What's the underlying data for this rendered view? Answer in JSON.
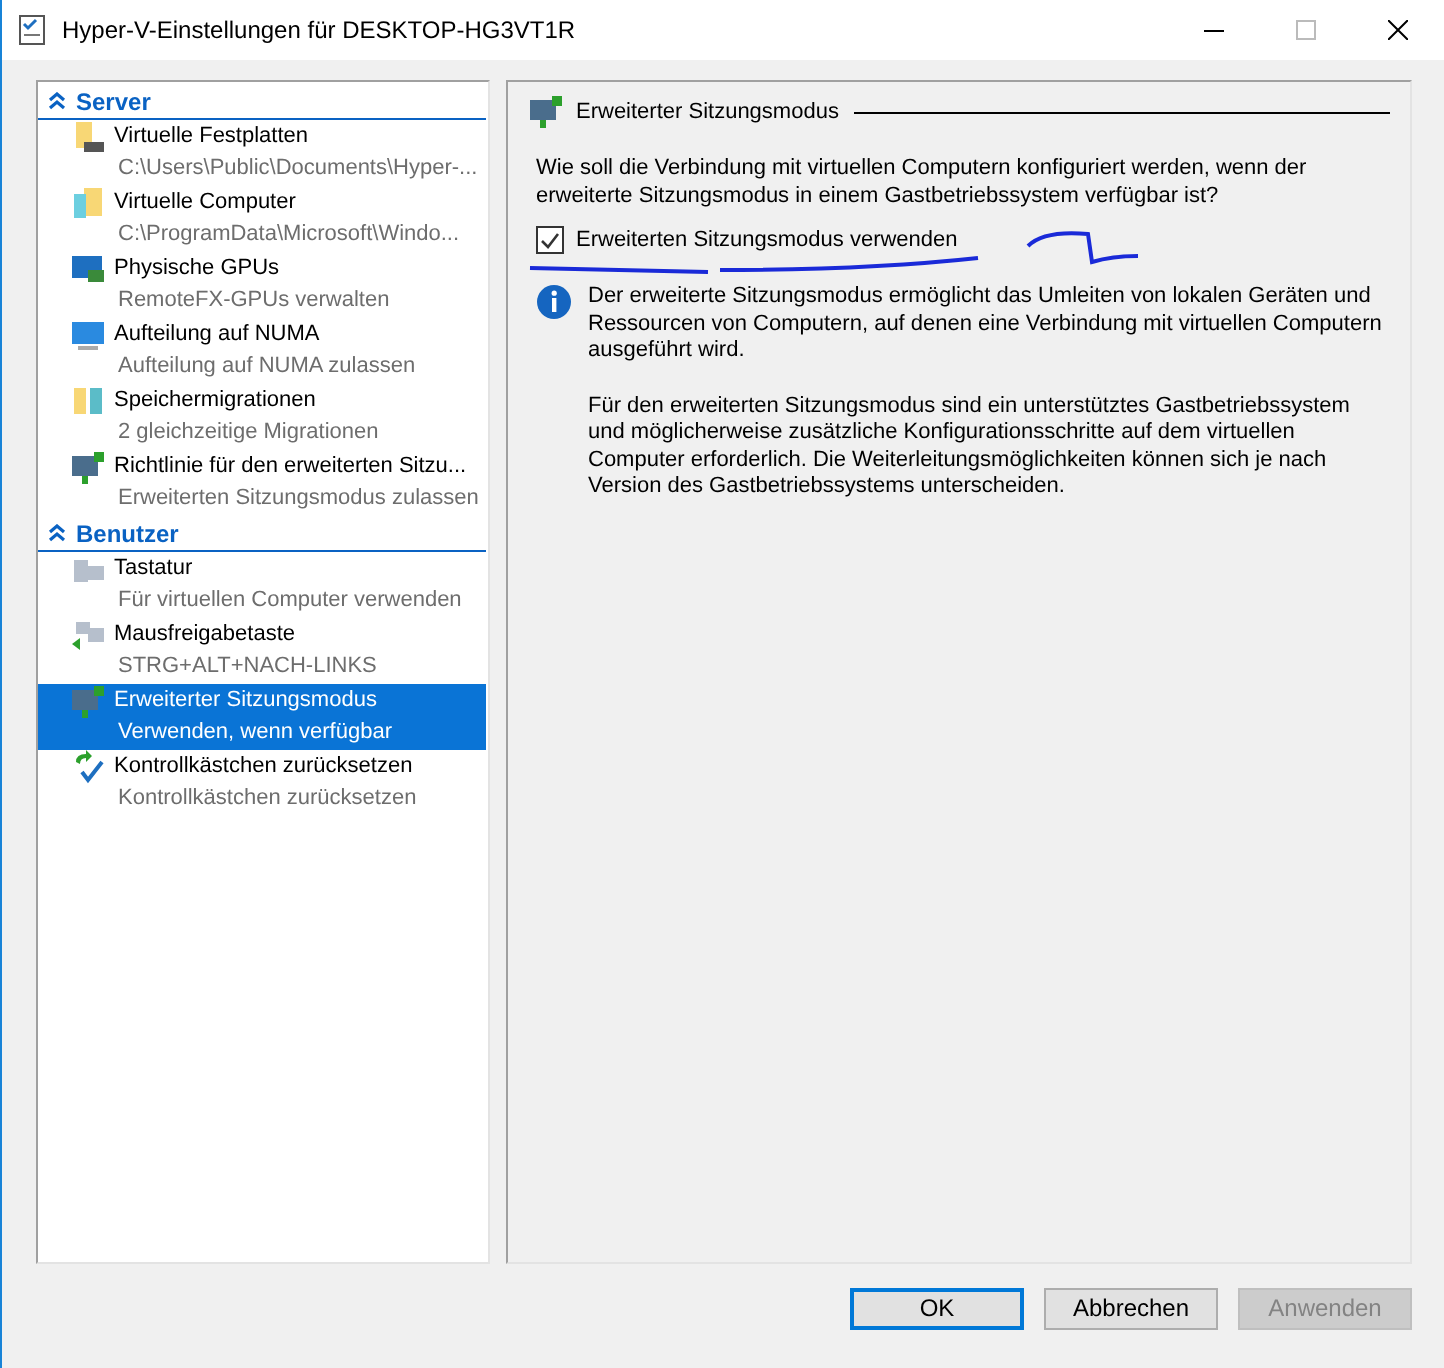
{
  "window": {
    "title": "Hyper-V-Einstellungen für DESKTOP-HG3VT1R"
  },
  "sidebar": {
    "sections": [
      {
        "title": "Server",
        "expanded": true,
        "items": [
          {
            "label": "Virtuelle Festplatten",
            "detail": "C:\\Users\\Public\\Documents\\Hyper-...",
            "selected": false
          },
          {
            "label": "Virtuelle Computer",
            "detail": "C:\\ProgramData\\Microsoft\\Windo...",
            "selected": false
          },
          {
            "label": "Physische GPUs",
            "detail": "RemoteFX-GPUs verwalten",
            "selected": false
          },
          {
            "label": "Aufteilung auf NUMA",
            "detail": "Aufteilung auf NUMA zulassen",
            "selected": false
          },
          {
            "label": "Speichermigrationen",
            "detail": "2 gleichzeitige Migrationen",
            "selected": false
          },
          {
            "label": "Richtlinie für den erweiterten Sitzu...",
            "detail": "Erweiterten Sitzungsmodus zulassen",
            "selected": false
          }
        ]
      },
      {
        "title": "Benutzer",
        "expanded": true,
        "items": [
          {
            "label": "Tastatur",
            "detail": "Für virtuellen Computer verwenden",
            "selected": false
          },
          {
            "label": "Mausfreigabetaste",
            "detail": "STRG+ALT+NACH-LINKS",
            "selected": false
          },
          {
            "label": "Erweiterter Sitzungsmodus",
            "detail": "Verwenden, wenn verfügbar",
            "selected": true
          },
          {
            "label": "Kontrollkästchen zurücksetzen",
            "detail": "Kontrollkästchen zurücksetzen",
            "selected": false
          }
        ]
      }
    ]
  },
  "panel": {
    "title": "Erweiterter Sitzungsmodus",
    "question": "Wie soll die Verbindung mit virtuellen Computern konfiguriert werden, wenn der erweiterte Sitzungsmodus in einem Gastbetriebssystem verfügbar ist?",
    "checkbox": {
      "label": "Erweiterten Sitzungsmodus verwenden",
      "checked": true
    },
    "info": [
      "Der erweiterte Sitzungsmodus ermöglicht das Umleiten von lokalen Geräten und Ressourcen von Computern, auf denen eine Verbindung mit virtuellen Computern ausgeführt wird.",
      "Für den erweiterten Sitzungsmodus sind ein unterstütztes Gastbetriebssystem und möglicherweise zusätzliche Konfigurationsschritte auf dem virtuellen Computer erforderlich. Die Weiterleitungsmöglichkeiten können sich je nach Version des Gastbetriebssystems unterscheiden."
    ]
  },
  "buttons": [
    {
      "label": "OK",
      "kind": "default",
      "disabled": false
    },
    {
      "label": "Abbrechen",
      "kind": "normal",
      "disabled": false
    },
    {
      "label": "Anwenden",
      "kind": "normal",
      "disabled": true
    }
  ]
}
